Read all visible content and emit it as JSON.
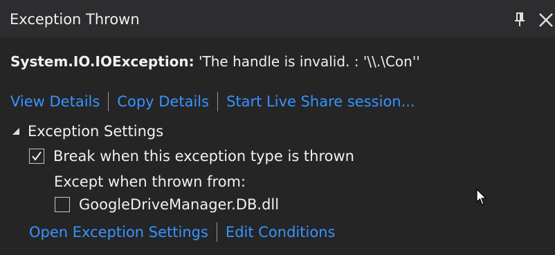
{
  "window": {
    "title": "Exception Thrown",
    "pin_icon": "pin-icon",
    "close_icon": "close-icon"
  },
  "exception": {
    "type": "System.IO.IOException:",
    "message": "'The handle is invalid. : '\\\\.\\Con''"
  },
  "links": {
    "view_details": "View Details",
    "copy_details": "Copy Details",
    "live_share": "Start Live Share session..."
  },
  "settings": {
    "header": "Exception Settings",
    "expanded": true,
    "break_when_thrown": {
      "label": "Break when this exception type is thrown",
      "checked": true
    },
    "except_label": "Except when thrown from:",
    "modules": [
      {
        "label": "GoogleDriveManager.DB.dll",
        "checked": false
      }
    ],
    "open_settings": "Open Exception Settings",
    "edit_conditions": "Edit Conditions"
  },
  "colors": {
    "background": "#252526",
    "titlebar": "#2d2d30",
    "text": "#f1f1f1",
    "link": "#3794ff"
  }
}
